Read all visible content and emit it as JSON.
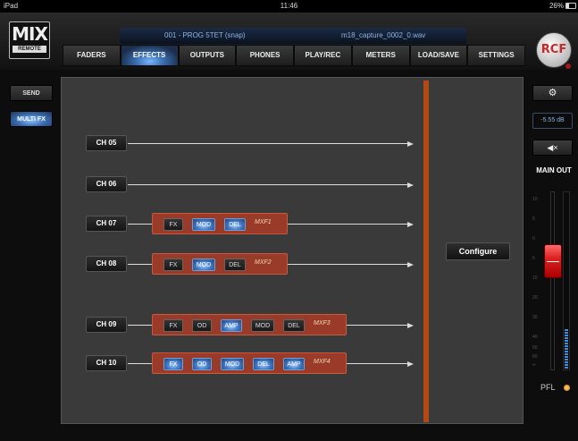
{
  "status_bar": {
    "device": "iPad",
    "time": "11:46",
    "battery": "26%",
    "battery_fraction": 0.26
  },
  "logo": {
    "line1": "MIX",
    "line2": "REMOTE"
  },
  "session": {
    "scene": "001 - PROG 5TET (snap)",
    "file": "m18_capture_0002_0.wav"
  },
  "tabs": [
    {
      "label": "FADERS"
    },
    {
      "label": "EFFECTS"
    },
    {
      "label": "OUTPUTS"
    },
    {
      "label": "PHONES"
    },
    {
      "label": "PLAY/REC"
    },
    {
      "label": "METERS"
    },
    {
      "label": "LOAD/SAVE"
    },
    {
      "label": "SETTINGS"
    }
  ],
  "active_tab": "EFFECTS",
  "brand_logo": "RCF",
  "left_nav": {
    "send": "SEND",
    "multifx": "MULTI FX"
  },
  "channels": [
    {
      "label": "CH 05",
      "chain": [],
      "fx_name": ""
    },
    {
      "label": "CH 06",
      "chain": [],
      "fx_name": ""
    },
    {
      "label": "CH 07",
      "chain": [
        {
          "label": "FX",
          "on": false
        },
        {
          "label": "MOD",
          "on": true
        },
        {
          "label": "DEL",
          "on": true
        }
      ],
      "fx_name": "MXF1"
    },
    {
      "label": "CH 08",
      "chain": [
        {
          "label": "FX",
          "on": false
        },
        {
          "label": "MOD",
          "on": true
        },
        {
          "label": "DEL",
          "on": false
        }
      ],
      "fx_name": "MXF2"
    },
    {
      "label": "CH 09",
      "chain": [
        {
          "label": "FX",
          "on": false
        },
        {
          "label": "OD",
          "on": false
        },
        {
          "label": "AMP",
          "on": true
        },
        {
          "label": "MOD",
          "on": false
        },
        {
          "label": "DEL",
          "on": false
        }
      ],
      "fx_name": "MXF3"
    },
    {
      "label": "CH 10",
      "chain": [
        {
          "label": "FX",
          "on": true
        },
        {
          "label": "OD",
          "on": true
        },
        {
          "label": "MOD",
          "on": true
        },
        {
          "label": "DEL",
          "on": true
        },
        {
          "label": "AMP",
          "on": true
        }
      ],
      "fx_name": "MXF4"
    }
  ],
  "configure_label": "Configure",
  "right_panel": {
    "settings_icon": "gear-icon",
    "level": "-5.55 dB",
    "mute_icon": "speaker-mute-icon",
    "main_out": "MAIN OUT",
    "fader_value_db": -5.55,
    "meter_fraction": 0.22,
    "pfl": "PFL"
  },
  "colors": {
    "accent_blue": "#3a6db0",
    "fx_chain": "#9a3b2a",
    "bus_orange": "#b24a16",
    "fader_red": "#d22222"
  }
}
